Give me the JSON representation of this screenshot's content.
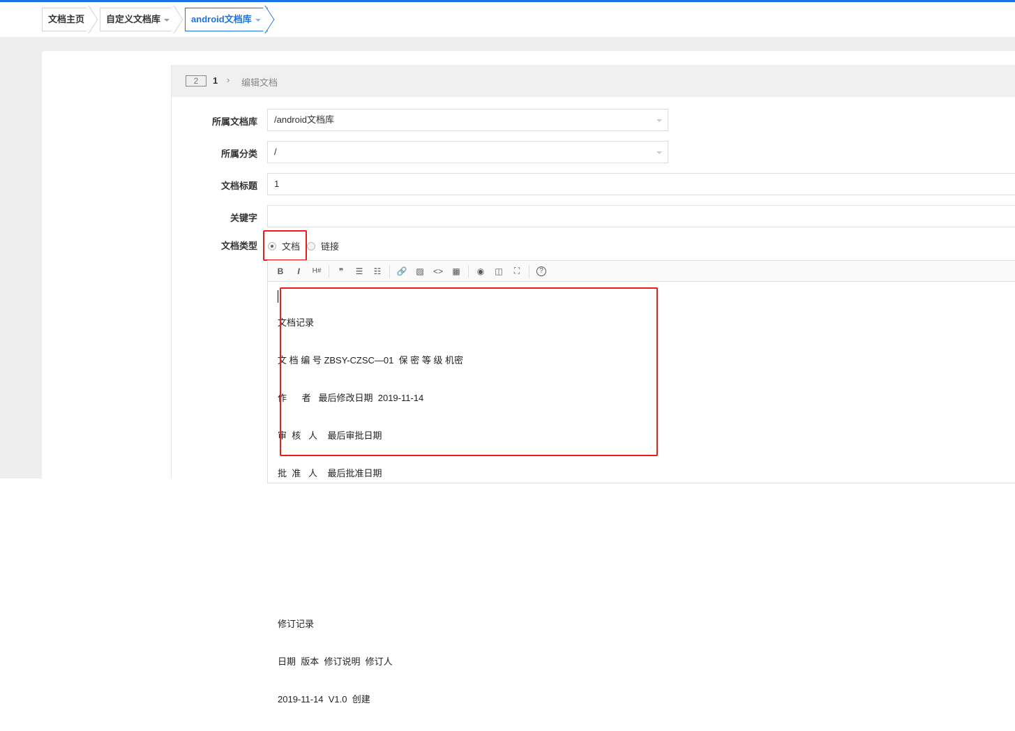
{
  "breadcrumb": [
    "文档主页",
    "自定义文档库",
    "android文档库"
  ],
  "panel": {
    "badge": "2",
    "number": "1",
    "chevron": "›",
    "title": "编辑文档"
  },
  "form": {
    "library": {
      "label": "所属文档库",
      "value": "/android文档库"
    },
    "category": {
      "label": "所属分类",
      "value": "/"
    },
    "title": {
      "label": "文档标题",
      "value": "1"
    },
    "keywords": {
      "label": "关键字",
      "value": ""
    },
    "type": {
      "label": "文档类型",
      "options": [
        "文档",
        "链接"
      ],
      "selected": "文档"
    }
  },
  "toolbar": {
    "bold": "B",
    "italic": "I",
    "heading": "H#",
    "quote": "❞",
    "ul": "☰",
    "ol": "☷",
    "link": "🔗",
    "image": "▨",
    "code": "<>",
    "table": "▦",
    "preview": "◉",
    "split": "◫",
    "fullscreen": "⛶",
    "help": "?"
  },
  "content": [
    "文档记录",
    "文 档 编 号 ZBSY-CZSC—01  保 密 等 级 机密",
    "作      者   最后修改日期  2019-11-14",
    "审  核   人    最后审批日期",
    "批  准   人    最后批准日期",
    "",
    "",
    "",
    "修订记录",
    "日期  版本  修订说明  修订人",
    "2019-11-14  V1.0  创建"
  ],
  "colors": {
    "accent": "#1a73e8",
    "highlight": "#f01a1a"
  }
}
